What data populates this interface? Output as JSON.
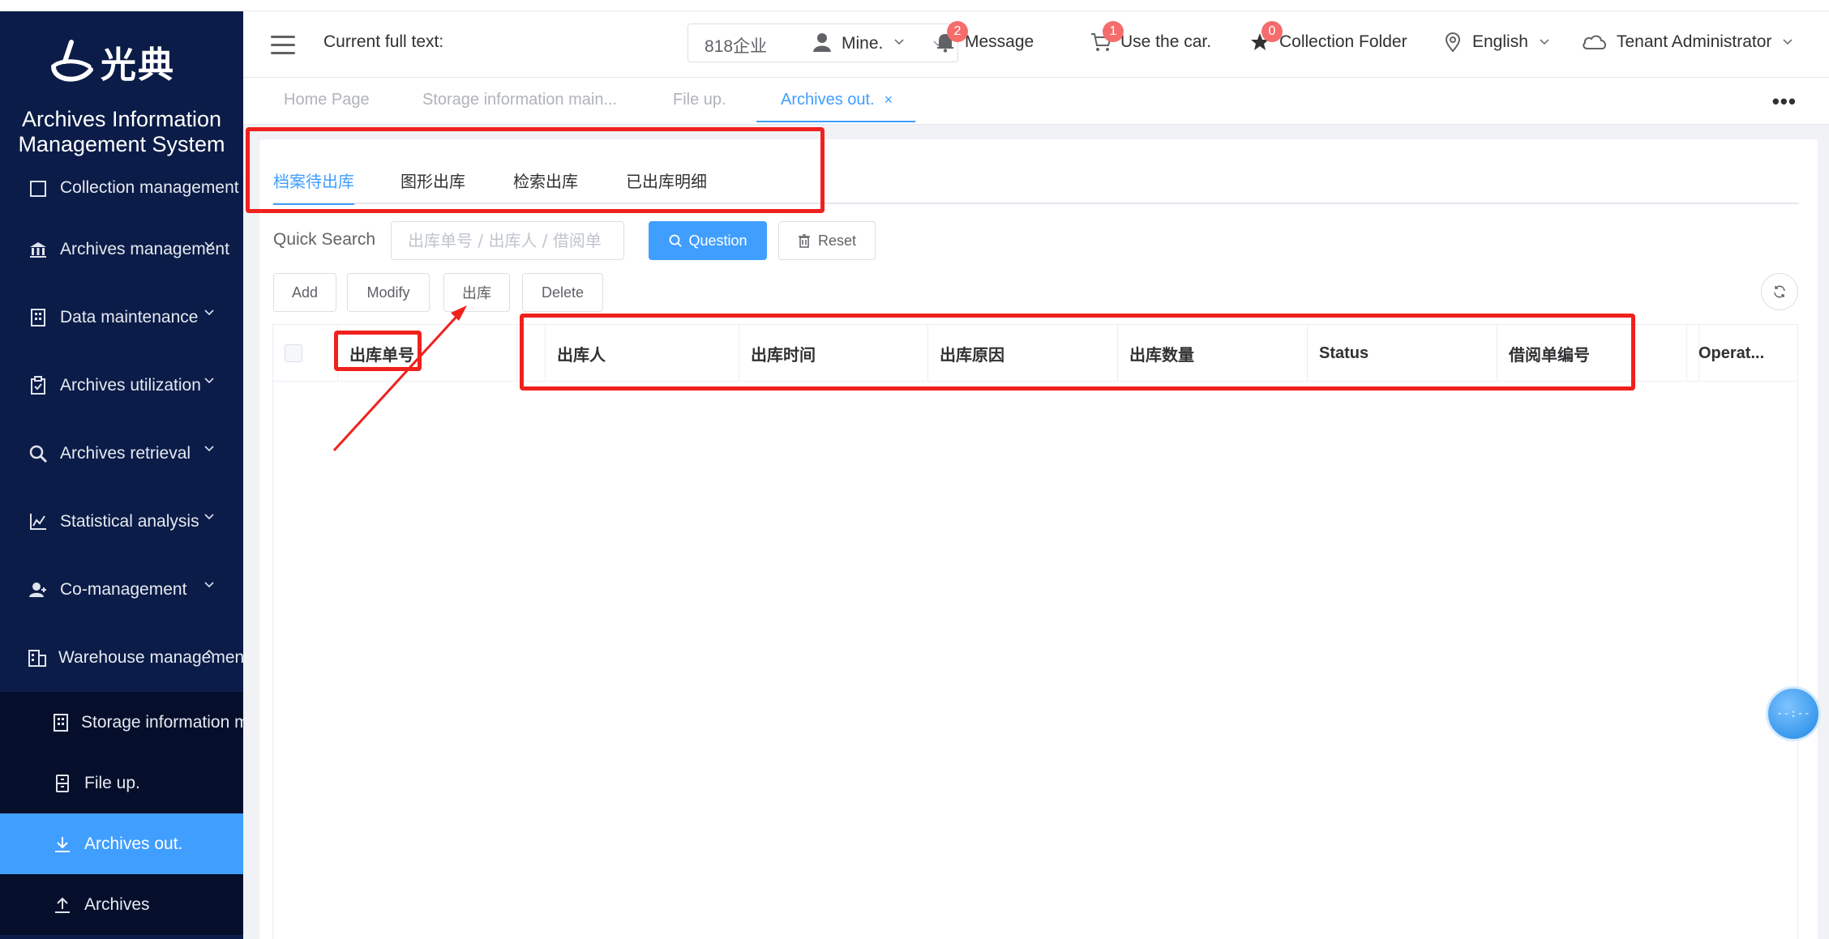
{
  "sidebar": {
    "logo_text": "光典",
    "system_title_line1": "Archives Information",
    "system_title_line2": "Management System",
    "items": [
      {
        "label": "Collection management",
        "icon": "square-icon"
      },
      {
        "label": "Archives management",
        "icon": "bank-icon"
      },
      {
        "label": "Data maintenance",
        "icon": "building-icon"
      },
      {
        "label": "Archives utilization",
        "icon": "clipboard-icon"
      },
      {
        "label": "Archives retrieval",
        "icon": "search-icon"
      },
      {
        "label": "Statistical analysis",
        "icon": "chart-icon"
      },
      {
        "label": "Co-management",
        "icon": "user-icon"
      },
      {
        "label": "Warehouse management",
        "icon": "warehouse-icon"
      }
    ],
    "subitems": [
      {
        "label": "Storage information maintenance",
        "icon": "building-icon"
      },
      {
        "label": "File up.",
        "icon": "cabinet-icon"
      },
      {
        "label": "Archives out.",
        "icon": "download-icon",
        "active": true
      },
      {
        "label": "Archives",
        "icon": "upload-icon"
      }
    ]
  },
  "header": {
    "current_label": "Current full text:",
    "tenant_value": "818企业",
    "mine": "Mine.",
    "message": "Message",
    "message_badge": "2",
    "use_car": "Use the car.",
    "car_badge": "1",
    "collection": "Collection Folder",
    "collection_badge": "0",
    "language": "English",
    "user": "Tenant Administrator"
  },
  "page_tabs": [
    {
      "label": "Home Page"
    },
    {
      "label": "Storage information main..."
    },
    {
      "label": "File up."
    },
    {
      "label": "Archives out.",
      "close": "×"
    }
  ],
  "inner_tabs": [
    "档案待出库",
    "图形出库",
    "检索出库",
    "已出库明细"
  ],
  "search": {
    "label": "Quick Search",
    "placeholder": "出库单号 / 出库人 / 借阅单",
    "question_btn": "Question",
    "reset_btn": "Reset"
  },
  "toolbar": {
    "add": "Add",
    "modify": "Modify",
    "outbound": "出库",
    "delete": "Delete"
  },
  "table": {
    "columns": [
      "出库单号",
      "",
      "出库人",
      "出库时间",
      "出库原因",
      "出库数量",
      "Status",
      "借阅单编号",
      "",
      "Operat..."
    ]
  },
  "float_clock": "--:--",
  "colors": {
    "sidebar_bg": "#0b1c48",
    "accent": "#409eff",
    "annotation": "#f0211d",
    "badge": "#f56c6c"
  }
}
